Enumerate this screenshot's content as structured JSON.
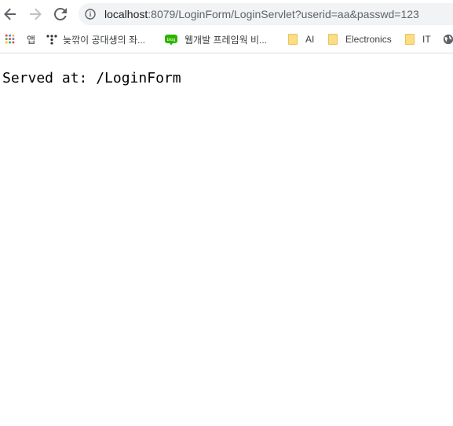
{
  "toolbar": {
    "back_icon": "back-arrow-icon",
    "forward_icon": "forward-arrow-icon",
    "reload_icon": "reload-icon"
  },
  "address_bar": {
    "host": "localhost",
    "rest": ":8079/LoginForm/LoginServlet?userid=aa&passwd=123",
    "icon": "info-icon"
  },
  "bookmarks": [
    {
      "label": "앱",
      "icon": "apps-grid-icon"
    },
    {
      "label": "늦깎이 공대생의 좌...",
      "icon": "tistory-icon"
    },
    {
      "label": "웹개발 프레임웍 비...",
      "icon": "blog-icon"
    },
    {
      "label": "AI",
      "icon": "folder-icon"
    },
    {
      "label": "Electronics",
      "icon": "folder-icon"
    },
    {
      "label": "IT",
      "icon": "folder-icon"
    }
  ],
  "page": {
    "body_text": "Served at: /LoginForm"
  },
  "colors": {
    "omnibox_bg": "#f1f3f4",
    "icon_gray": "#5f6368",
    "folder": "#fcdd83",
    "blog_green": "#2db400"
  }
}
